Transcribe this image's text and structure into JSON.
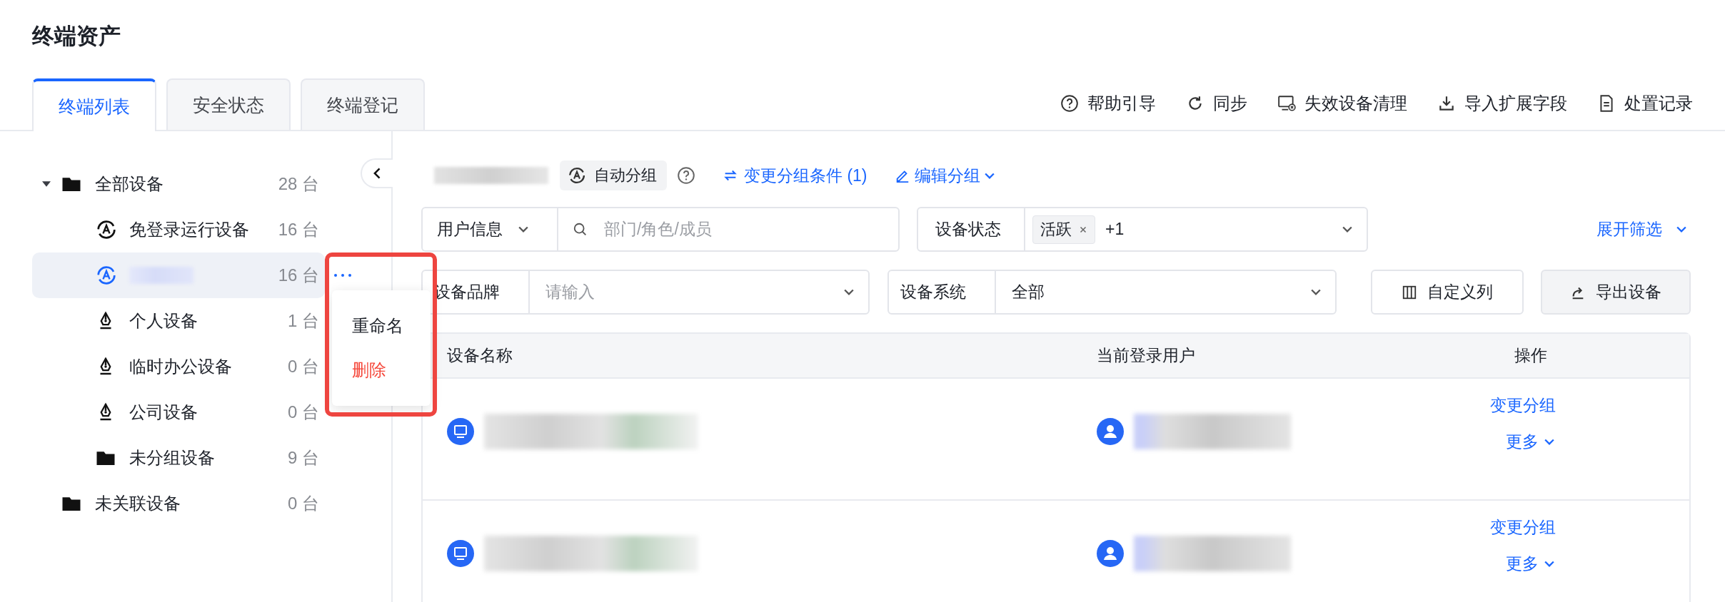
{
  "page_title": "终端资产",
  "tabs": [
    {
      "label": "终端列表",
      "selected": true
    },
    {
      "label": "安全状态",
      "selected": false
    },
    {
      "label": "终端登记",
      "selected": false
    }
  ],
  "toolbar": [
    {
      "label": "帮助引导",
      "kind": "help"
    },
    {
      "label": "同步",
      "kind": "sync"
    },
    {
      "label": "失效设备清理",
      "kind": "cleanup"
    },
    {
      "label": "导入扩展字段",
      "kind": "import"
    },
    {
      "label": "处置记录",
      "kind": "record"
    }
  ],
  "tree": [
    {
      "label": "全部设备",
      "count": "28 台",
      "kind": "folder",
      "expanded": true,
      "selected": false,
      "children": [
        {
          "label": "免登录运行设备",
          "count": "16 台",
          "kind": "auto",
          "selected": false
        },
        {
          "count": "16 台",
          "kind": "auto",
          "selected": true
        },
        {
          "label": "个人设备",
          "count": "1 台",
          "kind": "manual",
          "selected": false
        },
        {
          "label": "临时办公设备",
          "count": "0 台",
          "kind": "manual",
          "selected": false
        },
        {
          "label": "公司设备",
          "count": "0 台",
          "kind": "manual",
          "selected": false
        },
        {
          "label": "未分组设备",
          "count": "9 台",
          "kind": "folder",
          "selected": false
        }
      ]
    },
    {
      "label": "未关联设备",
      "count": "0 台",
      "kind": "folder",
      "selected": false
    }
  ],
  "context_menu": [
    {
      "label": "重命名",
      "kind": "normal"
    },
    {
      "label": "删除",
      "kind": "danger"
    }
  ],
  "group_header": {
    "badge": "自动分组",
    "links": [
      {
        "label": "变更分组条件 (1)",
        "kind": "change"
      },
      {
        "label": "编辑分组",
        "kind": "edit"
      }
    ]
  },
  "filters": {
    "user_select": "用户信息",
    "user_placeholder": "部门/角色/成员",
    "status_label": "设备状态",
    "status_tags": [
      "活跃"
    ],
    "status_more": "+1",
    "expand_link": "展开筛选",
    "brand_label": "设备品牌",
    "brand_placeholder": "请输入",
    "os_label": "设备系统",
    "os_value": "全部"
  },
  "buttons": [
    {
      "label": "自定义列",
      "kind": "columns"
    },
    {
      "label": "导出设备",
      "kind": "export"
    }
  ],
  "table": {
    "columns": [
      "设备名称",
      "当前登录用户",
      "操作"
    ],
    "rows": [
      {
        "change_action": "变更分组",
        "more_action": "更多"
      },
      {
        "change_action": "变更分组",
        "more_action": "更多"
      }
    ]
  }
}
